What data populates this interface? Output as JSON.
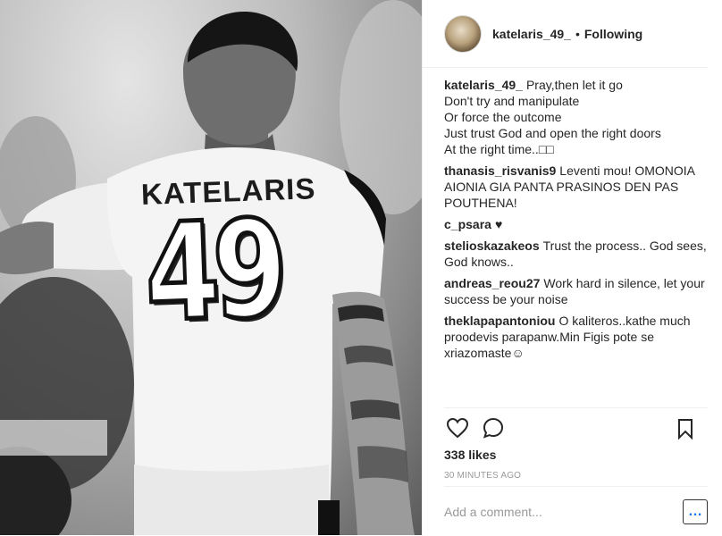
{
  "photo": {
    "jersey_name": "KATELARIS",
    "jersey_number": "49"
  },
  "header": {
    "username": "katelaris_49_",
    "separator": "•",
    "follow_status": "Following"
  },
  "caption": {
    "username": "katelaris_49_",
    "lines": [
      "Pray,then let it go",
      "Don't try and manipulate",
      "Or force the outcome",
      "Just trust God and open the right doors",
      "At the right time..□□"
    ]
  },
  "comments": [
    {
      "username": "thanasis_risvanis9",
      "text": "Leventi mou! OMONOIA AIONIA GIA PANTA PRASINOS DEN PAS POUTHENA!"
    },
    {
      "username": "c_psara",
      "text": "♥"
    },
    {
      "username": "stelioskazakeos",
      "text": "Trust the process.. God sees, God knows.."
    },
    {
      "username": "andreas_reou27",
      "text": "Work hard in silence, let your success be your noise"
    },
    {
      "username": "theklapapantoniou",
      "text": "O kaliteros..kathe much proodevis parapanw.Min Figis pote se xriazomaste☺"
    }
  ],
  "actions": {
    "like_icon": "heart-icon",
    "comment_icon": "comment-icon",
    "save_icon": "bookmark-icon"
  },
  "likes": "338 likes",
  "time": "30 MINUTES AGO",
  "add_comment": {
    "placeholder": "Add a comment...",
    "more_label": "…"
  }
}
